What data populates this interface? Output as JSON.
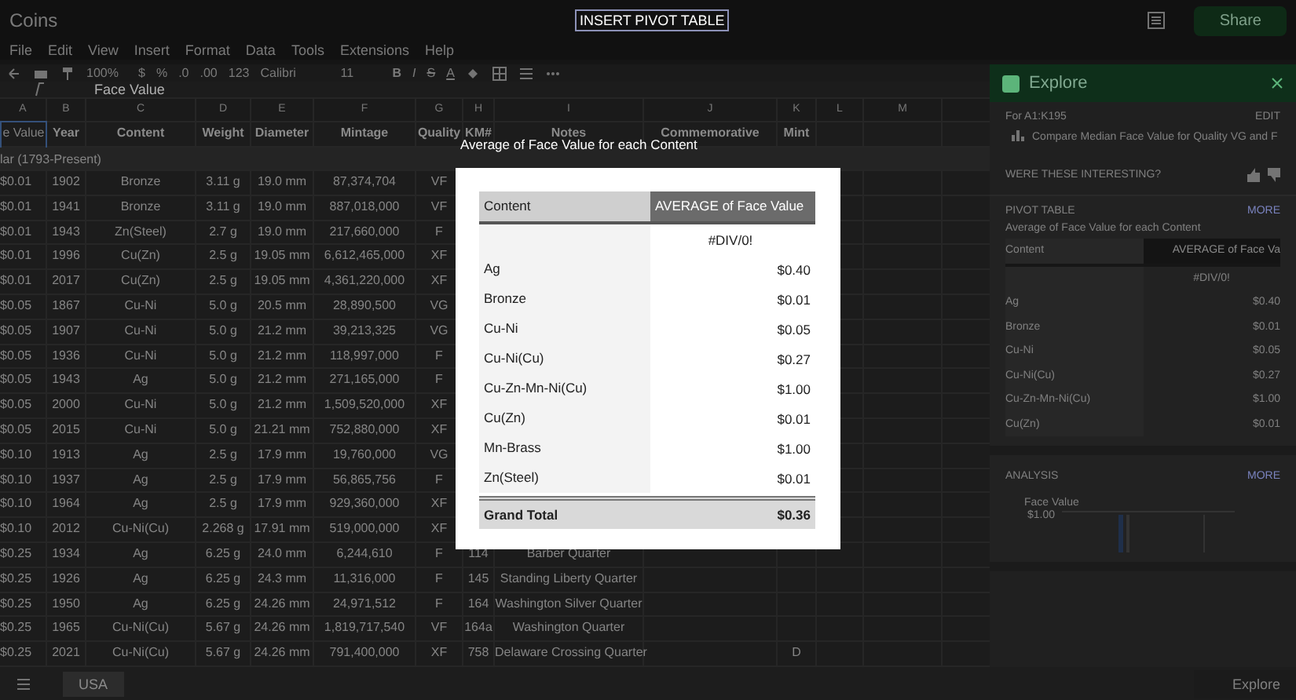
{
  "app": {
    "title": "Coins",
    "menu": [
      "File",
      "Edit",
      "View",
      "Insert",
      "Format",
      "Data",
      "Tools",
      "Extensions",
      "Help"
    ],
    "share_button": "Share"
  },
  "dialog_label": "INSERT PIVOT TABLE",
  "toolbar": {
    "zoom": "100%",
    "number_formats": [
      "$",
      "%",
      ".0",
      ".00",
      "123"
    ],
    "font": "Calibri",
    "font_size": "11",
    "text_formats": [
      "B",
      "I",
      "S",
      "A"
    ]
  },
  "formula_bar": {
    "value": "Face Value"
  },
  "sheet": {
    "columns": [
      "A",
      "B",
      "C",
      "D",
      "E",
      "F",
      "G",
      "H",
      "I",
      "J",
      "K",
      "L",
      "M"
    ],
    "header": [
      "e Value",
      "Year",
      "Content",
      "Weight",
      "Diameter",
      "Mintage",
      "Quality",
      "KM#",
      "Notes",
      "Commemorative",
      "Mint"
    ],
    "group": "lar (1793-Present)",
    "rows": [
      {
        "cells": [
          "$0.01",
          "1902",
          "Bronze",
          "3.11 g",
          "19.0 mm",
          "87,374,704",
          "VF"
        ]
      },
      {
        "cells": [
          "$0.01",
          "1941",
          "Bronze",
          "3.11 g",
          "19.0 mm",
          "887,018,000",
          "VF"
        ]
      },
      {
        "cells": [
          "$0.01",
          "1943",
          "Zn(Steel)",
          "2.7 g",
          "19.0 mm",
          "217,660,000",
          "F"
        ]
      },
      {
        "cells": [
          "$0.01",
          "1996",
          "Cu(Zn)",
          "2.5 g",
          "19.05 mm",
          "6,612,465,000",
          "XF"
        ]
      },
      {
        "cells": [
          "$0.01",
          "2017",
          "Cu(Zn)",
          "2.5 g",
          "19.05 mm",
          "4,361,220,000",
          "XF"
        ]
      },
      {
        "cells": [
          "$0.05",
          "1867",
          "Cu-Ni",
          "5.0 g",
          "20.5 mm",
          "28,890,500",
          "VG"
        ]
      },
      {
        "cells": [
          "$0.05",
          "1907",
          "Cu-Ni",
          "5.0 g",
          "21.2 mm",
          "39,213,325",
          "VG"
        ]
      },
      {
        "cells": [
          "$0.05",
          "1936",
          "Cu-Ni",
          "5.0 g",
          "21.2 mm",
          "118,997,000",
          "F"
        ]
      },
      {
        "cells": [
          "$0.05",
          "1943",
          "Ag",
          "5.0 g",
          "21.2 mm",
          "271,165,000",
          "F"
        ]
      },
      {
        "cells": [
          "$0.05",
          "2000",
          "Cu-Ni",
          "5.0 g",
          "21.2 mm",
          "1,509,520,000",
          "XF"
        ]
      },
      {
        "cells": [
          "$0.05",
          "2015",
          "Cu-Ni",
          "5.0 g",
          "21.21 mm",
          "752,880,000",
          "XF"
        ]
      },
      {
        "cells": [
          "$0.10",
          "1913",
          "Ag",
          "2.5 g",
          "17.9 mm",
          "19,760,000",
          "VG"
        ]
      },
      {
        "cells": [
          "$0.10",
          "1937",
          "Ag",
          "2.5 g",
          "17.9 mm",
          "56,865,756",
          "F"
        ]
      },
      {
        "cells": [
          "$0.10",
          "1964",
          "Ag",
          "2.5 g",
          "17.9 mm",
          "929,360,000",
          "XF"
        ]
      },
      {
        "cells": [
          "$0.10",
          "2012",
          "Cu-Ni(Cu)",
          "2.268 g",
          "17.91 mm",
          "519,000,000",
          "XF"
        ]
      },
      {
        "cells": [
          "$0.25",
          "1934",
          "Ag",
          "6.25 g",
          "24.0 mm",
          "6,244,610",
          "F",
          "114",
          "Barber Quarter"
        ]
      },
      {
        "cells": [
          "$0.25",
          "1926",
          "Ag",
          "6.25 g",
          "24.3 mm",
          "11,316,000",
          "F",
          "145",
          "Standing Liberty Quarter"
        ]
      },
      {
        "cells": [
          "$0.25",
          "1950",
          "Ag",
          "6.25 g",
          "24.26 mm",
          "24,971,512",
          "F",
          "164",
          "Washington Silver Quarter"
        ]
      },
      {
        "cells": [
          "$0.25",
          "1965",
          "Cu-Ni(Cu)",
          "5.67 g",
          "24.26 mm",
          "1,819,717,540",
          "VF",
          "164a",
          "Washington Quarter"
        ]
      },
      {
        "cells": [
          "$0.25",
          "2021",
          "Cu-Ni(Cu)",
          "5.67 g",
          "24.26 mm",
          "791,400,000",
          "XF",
          "758",
          "Delaware Crossing Quarter"
        ],
        "mint": "D"
      }
    ]
  },
  "pivot_dialog": {
    "title": "Average of Face Value for each Content",
    "columns": [
      "Content",
      "AVERAGE of Face Value"
    ],
    "rows": [
      {
        "value": "#DIV/0!"
      },
      {
        "label": "Ag",
        "value": "$0.40"
      },
      {
        "label": "Bronze",
        "value": "$0.01"
      },
      {
        "label": "Cu-Ni",
        "value": "$0.05"
      },
      {
        "label": "Cu-Ni(Cu)",
        "value": "$0.27"
      },
      {
        "label": "Cu-Zn-Mn-Ni(Cu)",
        "value": "$1.00"
      },
      {
        "label": "Cu(Zn)",
        "value": "$0.01"
      },
      {
        "label": "Mn-Brass",
        "value": "$1.00"
      },
      {
        "label": "Zn(Steel)",
        "value": "$0.01"
      }
    ],
    "total": {
      "label": "Grand Total",
      "value": "$0.36"
    }
  },
  "explore": {
    "title": "Explore",
    "range": "For A1:K195",
    "edit": "EDIT",
    "suggestion": "Compare Median Face Value for Quality VG and F",
    "feedback": "WERE THESE INTERESTING?",
    "pivot_card": {
      "heading": "PIVOT TABLE",
      "more": "MORE",
      "subtitle": "Average of Face Value for each Content",
      "columns": [
        "Content",
        "AVERAGE of Face Va"
      ],
      "rows": [
        {
          "value": "#DIV/0!"
        },
        {
          "label": "Ag",
          "value": "$0.40"
        },
        {
          "label": "Bronze",
          "value": "$0.01"
        },
        {
          "label": "Cu-Ni",
          "value": "$0.05"
        },
        {
          "label": "Cu-Ni(Cu)",
          "value": "$0.27"
        },
        {
          "label": "Cu-Zn-Mn-Ni(Cu)",
          "value": "$1.00"
        },
        {
          "label": "Cu(Zn)",
          "value": "$0.01"
        }
      ]
    },
    "analysis_card": {
      "heading": "ANALYSIS",
      "more": "MORE",
      "axis_title": "Face Value",
      "axis_value": "$1.00"
    }
  },
  "sheet_tabs": [
    {
      "label": "USA",
      "selected": true
    }
  ],
  "explore_button": "Explore"
}
